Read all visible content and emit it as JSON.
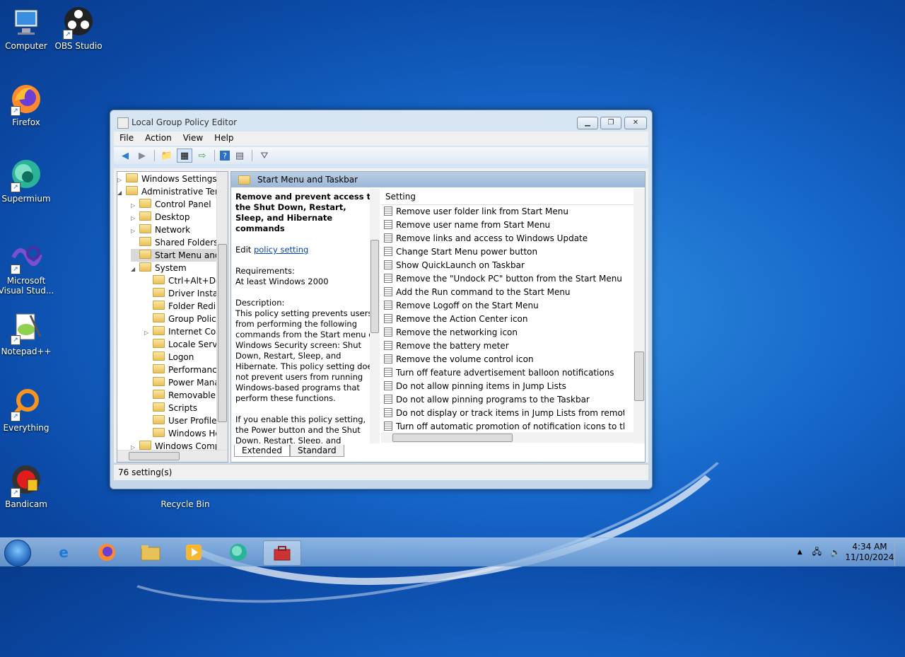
{
  "desktop": {
    "icons": [
      {
        "label": "Computer"
      },
      {
        "label": "OBS Studio"
      },
      {
        "label": "Firefox"
      },
      {
        "label": "Supermium"
      },
      {
        "label": "Microsoft Visual Stud..."
      },
      {
        "label": "Notepad++"
      },
      {
        "label": "Everything"
      },
      {
        "label": "Bandicam"
      },
      {
        "label": "Recycle Bin"
      }
    ]
  },
  "window": {
    "title": "Local Group Policy Editor",
    "menu": [
      "File",
      "Action",
      "View",
      "Help"
    ],
    "tree": [
      "Windows Settings",
      "Administrative Tem",
      "Control Panel",
      "Desktop",
      "Network",
      "Shared Folders",
      "Start Menu and",
      "System",
      "Ctrl+Alt+De",
      "Driver Install",
      "Folder Redire",
      "Group Policy",
      "Internet Con",
      "Locale Servic",
      "Logon",
      "Performance",
      "Power Mana",
      "Removable S",
      "Scripts",
      "User Profiles",
      "Windows Ho",
      "Windows Comp"
    ],
    "pane_header": "Start Menu and Taskbar",
    "description": {
      "heading": "Remove and prevent access to the Shut Down, Restart, Sleep, and Hibernate commands",
      "edit_prefix": "Edit",
      "edit_link": "policy setting",
      "requirements_label": "Requirements:",
      "requirements_value": "At least Windows 2000",
      "description_label": "Description:",
      "description_text": "This policy setting prevents users from performing the following commands from the Start menu or Windows Security screen: Shut Down, Restart, Sleep, and Hibernate. This policy setting does not prevent users from running Windows-based programs that perform these functions.",
      "enable_text": "If you enable this policy setting, the Power button and the Shut Down, Restart, Sleep, and Hibernate commands are"
    },
    "list_header": "Setting",
    "settings": [
      "Remove user folder link from Start Menu",
      "Remove user name from Start Menu",
      "Remove links and access to Windows Update",
      "Change Start Menu power button",
      "Show QuickLaunch on Taskbar",
      "Remove the \"Undock PC\" button from the Start Menu",
      "Add the Run command to the Start Menu",
      "Remove Logoff on the Start Menu",
      "Remove the Action Center icon",
      "Remove the networking icon",
      "Remove the battery meter",
      "Remove the volume control icon",
      "Turn off feature advertisement balloon notifications",
      "Do not allow pinning items in Jump Lists",
      "Do not allow pinning programs to the Taskbar",
      "Do not display or track items in Jump Lists from remote loca...",
      "Turn off automatic promotion of notification icons to the ta..."
    ],
    "tabs": [
      "Extended",
      "Standard"
    ],
    "status": "76 setting(s)"
  },
  "taskbar": {
    "time": "4:34 AM",
    "date": "11/10/2024"
  }
}
